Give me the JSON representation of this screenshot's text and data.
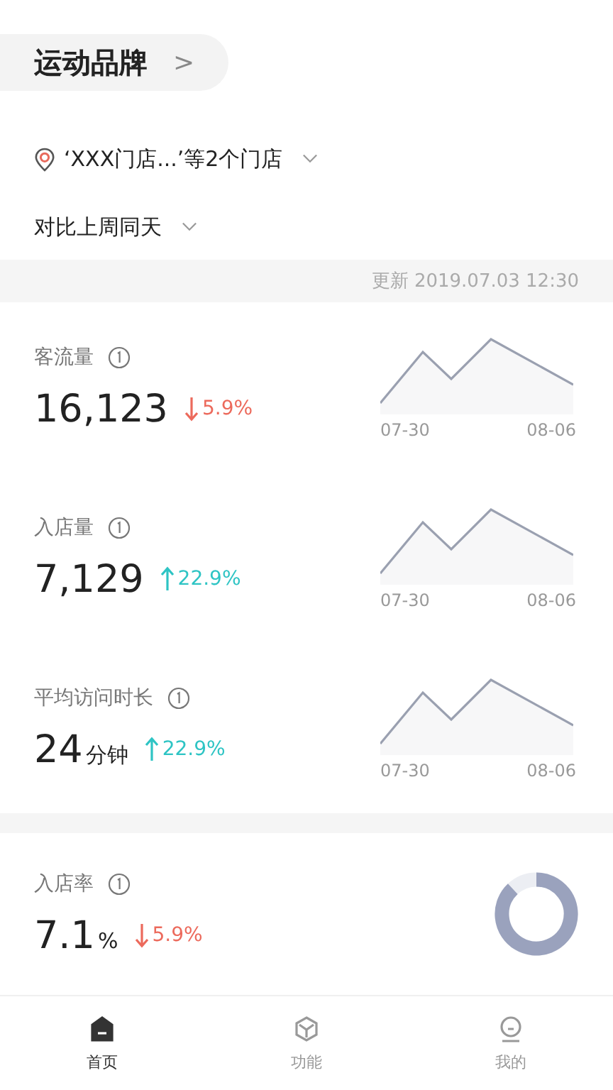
{
  "header": {
    "title": "运动品牌",
    "chevron": ">"
  },
  "store_filter": {
    "label": "‘XXX门店...’等2个门店"
  },
  "compare_filter": {
    "label": "对比上周同天"
  },
  "update_bar": {
    "text": "更新 2019.07.03 12:30"
  },
  "metrics": [
    {
      "kind": "sparkline",
      "title": "客流量",
      "value": "16,123",
      "change": "5.9%",
      "down": true,
      "x_start": "07-30",
      "x_end": "08-06"
    },
    {
      "kind": "sparkline",
      "title": "入店量",
      "value": "7,129",
      "change": "22.9%",
      "down": false,
      "x_start": "07-30",
      "x_end": "08-06"
    },
    {
      "kind": "sparkline",
      "title": "平均访问时长",
      "value": "24",
      "unit": "分钟",
      "change": "22.9%",
      "down": false,
      "x_start": "07-30",
      "x_end": "08-06"
    },
    {
      "kind": "donut",
      "title": "入店率",
      "value": "7.1",
      "unit": "%",
      "change": "5.9%",
      "down": true
    }
  ],
  "tab_bar": [
    {
      "label": "首页",
      "selected": true
    },
    {
      "label": "功能",
      "selected": false
    },
    {
      "label": "我的",
      "selected": false
    }
  ]
}
